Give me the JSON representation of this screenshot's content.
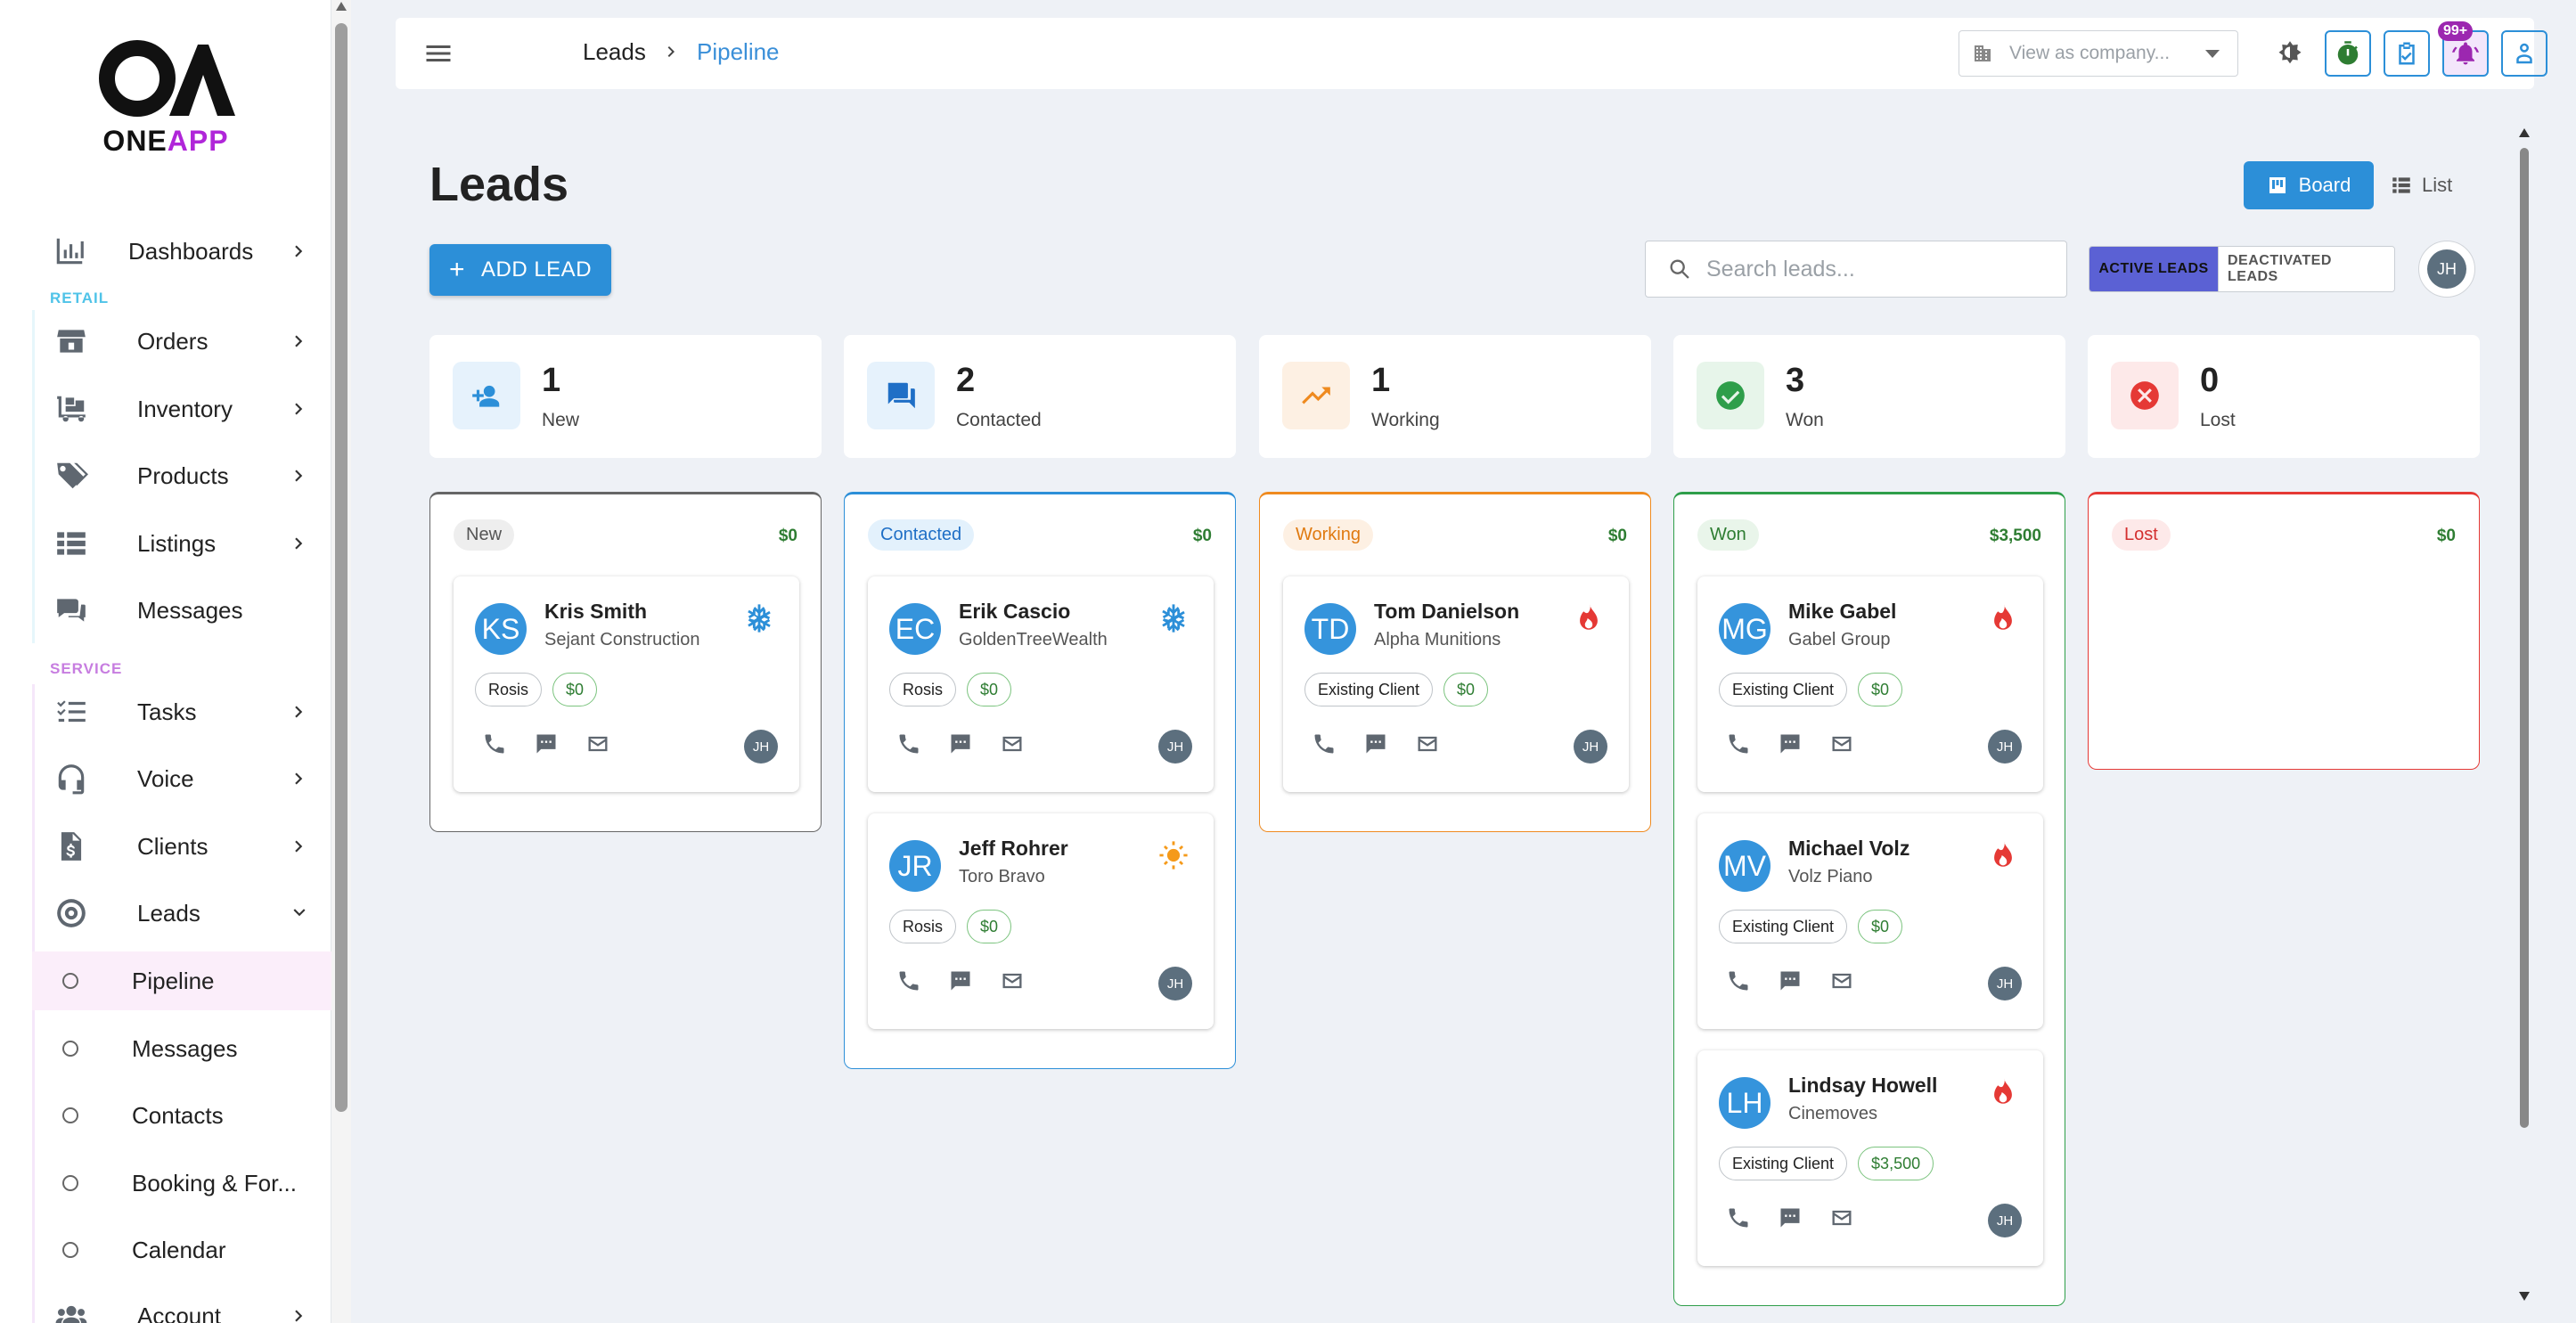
{
  "app": {
    "logo_top": "OA",
    "logo_word_one": "ONE",
    "logo_word_app": "APP"
  },
  "sidebar": {
    "dashboards": "Dashboards",
    "retail_label": "RETAIL",
    "service_label": "SERVICE",
    "items": [
      {
        "label": "Orders",
        "icon": "store-icon"
      },
      {
        "label": "Inventory",
        "icon": "dolly-icon"
      },
      {
        "label": "Products",
        "icon": "tags-icon"
      },
      {
        "label": "Listings",
        "icon": "list-icon"
      },
      {
        "label": "Messages",
        "icon": "chat-icon"
      }
    ],
    "service_items": [
      {
        "label": "Tasks",
        "icon": "checklist-icon"
      },
      {
        "label": "Voice",
        "icon": "headset-icon"
      },
      {
        "label": "Clients",
        "icon": "invoice-icon"
      },
      {
        "label": "Leads",
        "icon": "target-icon"
      }
    ],
    "leads_sub": [
      "Pipeline",
      "Messages",
      "Contacts",
      "Booking & For...",
      "Calendar"
    ],
    "account": "Account",
    "colors": {
      "retail": "#4fc3e8",
      "service": "#c77de0"
    }
  },
  "topbar": {
    "breadcrumb_root": "Leads",
    "breadcrumb_current": "Pipeline",
    "company_placeholder": "View as company...",
    "notification_badge": "99+"
  },
  "page": {
    "title": "Leads",
    "view_board": "Board",
    "view_list": "List",
    "add_lead": "ADD LEAD",
    "search_placeholder": "Search leads...",
    "toggle_active": "ACTIVE LEADS",
    "toggle_inactive": "DEACTIVATED LEADS",
    "user_initials": "JH"
  },
  "stats": [
    {
      "count": "1",
      "label": "New",
      "icon": "person-add-icon",
      "color": "#2c8fd8",
      "bg": "#e6f2fc"
    },
    {
      "count": "2",
      "label": "Contacted",
      "icon": "forum-icon",
      "color": "#1f6fc6",
      "bg": "#e6f2fc"
    },
    {
      "count": "1",
      "label": "Working",
      "icon": "trending-up-icon",
      "color": "#ef8a1f",
      "bg": "#fdf0e3"
    },
    {
      "count": "3",
      "label": "Won",
      "icon": "check-circle-icon",
      "color": "#2e9e4a",
      "bg": "#e7f5ea"
    },
    {
      "count": "0",
      "label": "Lost",
      "icon": "cancel-icon",
      "color": "#e53935",
      "bg": "#fde9e9"
    }
  ],
  "columns": [
    {
      "name": "New",
      "total": "$0",
      "border": "#666666",
      "chip_bg": "#eeeeee",
      "chip_fg": "#555555",
      "cards": [
        {
          "initials": "KS",
          "name": "Kris Smith",
          "company": "Sejant Construction",
          "tag": "Rosis",
          "value": "$0",
          "temp": "cold",
          "owner": "JH"
        }
      ]
    },
    {
      "name": "Contacted",
      "total": "$0",
      "border": "#2c8fd8",
      "chip_bg": "#e3f1fc",
      "chip_fg": "#1f6fc6",
      "cards": [
        {
          "initials": "EC",
          "name": "Erik Cascio",
          "company": "GoldenTreeWealth",
          "tag": "Rosis",
          "value": "$0",
          "temp": "cold",
          "owner": "JH"
        },
        {
          "initials": "JR",
          "name": "Jeff Rohrer",
          "company": "Toro Bravo",
          "tag": "Rosis",
          "value": "$0",
          "temp": "warm",
          "owner": "JH"
        }
      ]
    },
    {
      "name": "Working",
      "total": "$0",
      "border": "#ef8a1f",
      "chip_bg": "#fdf0e3",
      "chip_fg": "#e07a10",
      "cards": [
        {
          "initials": "TD",
          "name": "Tom Danielson",
          "company": "Alpha Munitions",
          "tag": "Existing Client",
          "value": "$0",
          "temp": "hot",
          "owner": "JH"
        }
      ]
    },
    {
      "name": "Won",
      "total": "$3,500",
      "border": "#2e9e4a",
      "chip_bg": "#e9f5ea",
      "chip_fg": "#2e7d32",
      "cards": [
        {
          "initials": "MG",
          "name": "Mike Gabel",
          "company": "Gabel Group",
          "tag": "Existing Client",
          "value": "$0",
          "temp": "hot",
          "owner": "JH"
        },
        {
          "initials": "MV",
          "name": "Michael Volz",
          "company": "Volz Piano",
          "tag": "Existing Client",
          "value": "$0",
          "temp": "hot",
          "owner": "JH"
        },
        {
          "initials": "LH",
          "name": "Lindsay Howell",
          "company": "Cinemoves",
          "tag": "Existing Client",
          "value": "$3,500",
          "temp": "hot",
          "owner": "JH"
        }
      ]
    },
    {
      "name": "Lost",
      "total": "$0",
      "border": "#e53935",
      "chip_bg": "#fde9e9",
      "chip_fg": "#d32f2f",
      "cards": []
    }
  ]
}
